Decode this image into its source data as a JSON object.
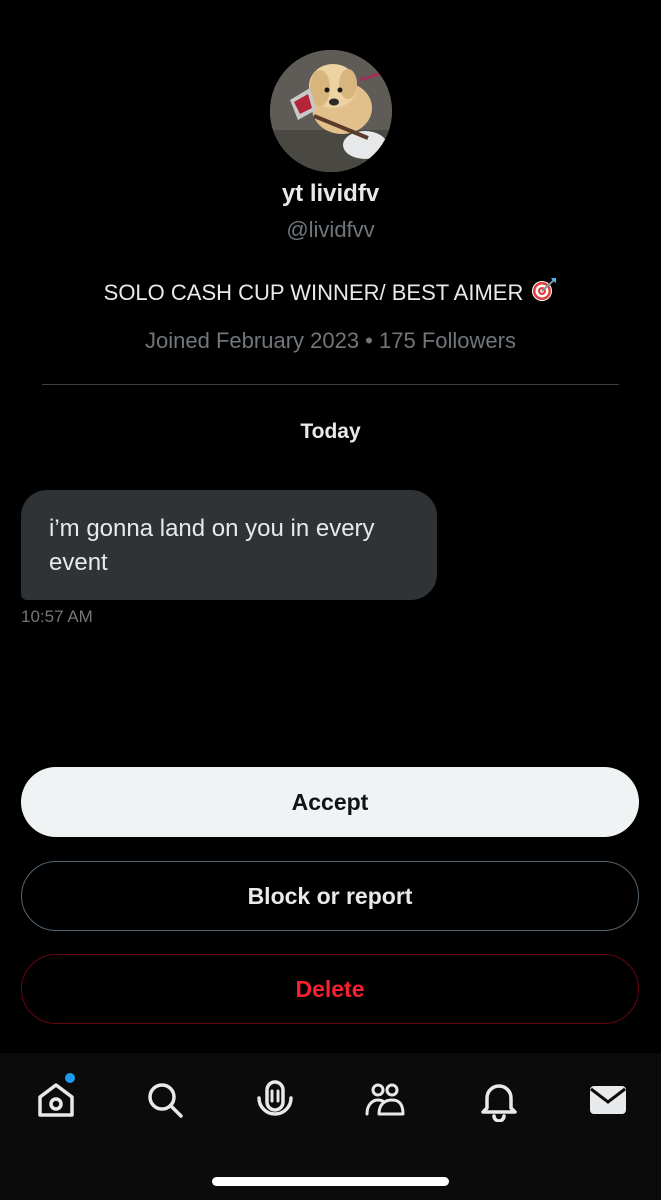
{
  "profile": {
    "name": "yt lividfv",
    "handle": "@lividfvv",
    "bio": "SOLO CASH CUP WINNER/ BEST AIMER",
    "bio_emoji": "target-dart-icon",
    "meta": "Joined February 2023 • 175 Followers"
  },
  "conversation": {
    "date_label": "Today",
    "messages": [
      {
        "text": "i’m gonna land on you in every event",
        "time": "10:57 AM"
      }
    ]
  },
  "actions": {
    "accept_label": "Accept",
    "block_label": "Block or report",
    "delete_label": "Delete"
  },
  "nav": {
    "items": [
      "home-icon",
      "search-icon",
      "spaces-icon",
      "communities-icon",
      "notifications-icon",
      "messages-icon"
    ],
    "home_has_badge": true
  },
  "colors": {
    "background": "#000000",
    "text_primary": "#e7e9ea",
    "text_secondary": "#71767b",
    "bubble": "#2f3336",
    "accept_bg": "#eff3f4",
    "delete_red": "#f4212e",
    "badge_blue": "#1d9bf0"
  }
}
